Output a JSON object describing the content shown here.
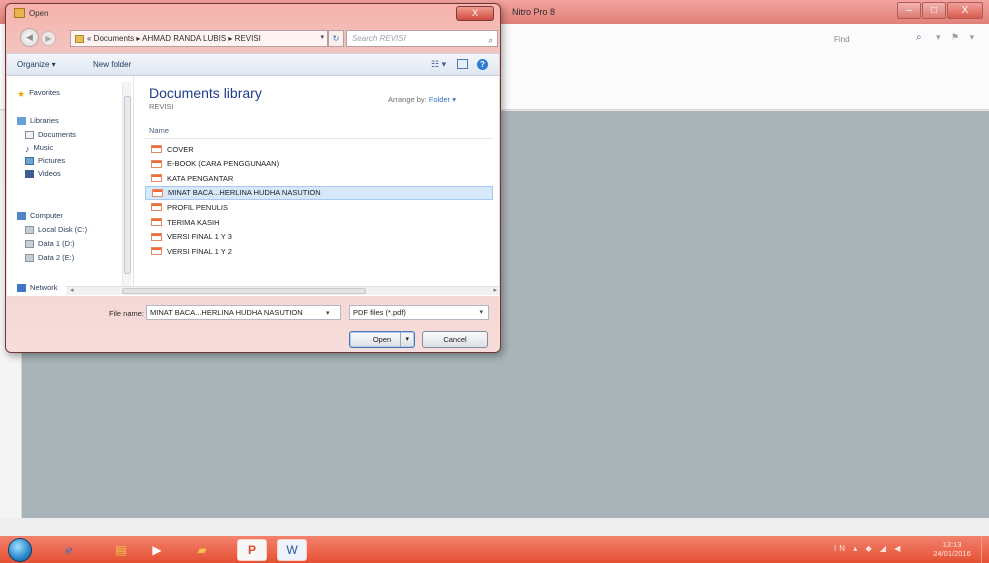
{
  "app": {
    "title": "Nitro Pro 8",
    "find_placeholder": "Find",
    "window_buttons": [
      "–",
      "□",
      "X"
    ]
  },
  "dialog": {
    "title": "Open",
    "close_label": "X",
    "address_path": "« Documents ▸ AHMAD RANDA LUBIS ▸ REVISI",
    "search_placeholder": "Search REVISI",
    "commands": {
      "organize": "Organize ▾",
      "new_folder": "New folder"
    },
    "nav": {
      "favorites": "Favorites",
      "libraries": "Libraries",
      "documents": "Documents",
      "music": "Music",
      "pictures": "Pictures",
      "videos": "Videos",
      "computer": "Computer",
      "local_disk": "Local Disk (C:)",
      "data1": "Data 1 (D:)",
      "data2": "Data 2 (E:)",
      "network": "Network"
    },
    "library_title": "Documents library",
    "library_sub": "REVISI",
    "arrange_by_label": "Arrange by:",
    "arrange_by_value": "Folder ▾",
    "column_name": "Name",
    "files": [
      "COVER",
      "E-BOOK (CARA PENGGUNAAN)",
      "KATA PENGANTAR",
      "MINAT BACA...HERLINA HUDHA NASUTION",
      "PROFIL PENULIS",
      "TERIMA KASIH",
      "VERSI FINAL 1 Y 3",
      "VERSI FINAL 1 Y 2"
    ],
    "selected_file_index": 3,
    "file_name_label": "File name:",
    "file_name_value": "MINAT BACA...HERLINA HUDHA NASUTION",
    "file_type_value": "PDF files (*.pdf)",
    "open_label": "Open",
    "cancel_label": "Cancel"
  },
  "taskbar": {
    "clock_time": "13:13",
    "clock_date": "24/01/2016",
    "tray_text": "IN ▴ ◆ ◢ ◀"
  }
}
